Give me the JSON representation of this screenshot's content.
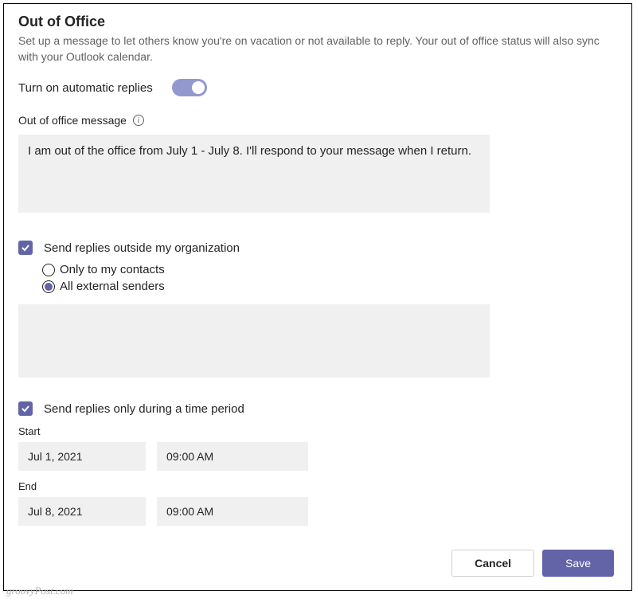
{
  "title": "Out of Office",
  "description": "Set up a message to let others know you're on vacation or not available to reply. Your out of office status will also sync with your Outlook calendar.",
  "toggle": {
    "label": "Turn on automatic replies",
    "on": true
  },
  "message": {
    "label": "Out of office message",
    "value": "I am out of the office from July 1 - July 8. I'll respond to your message when I return."
  },
  "sendOutside": {
    "checked": true,
    "label": "Send replies outside my organization",
    "options": {
      "contacts": "Only to my contacts",
      "all": "All external senders"
    },
    "selected": "all"
  },
  "timePeriod": {
    "checked": true,
    "label": "Send replies only during a time period",
    "startLabel": "Start",
    "startDate": "Jul 1, 2021",
    "startTime": "09:00 AM",
    "endLabel": "End",
    "endDate": "Jul 8, 2021",
    "endTime": "09:00 AM"
  },
  "buttons": {
    "cancel": "Cancel",
    "save": "Save"
  },
  "watermark": "groovyPost.com"
}
